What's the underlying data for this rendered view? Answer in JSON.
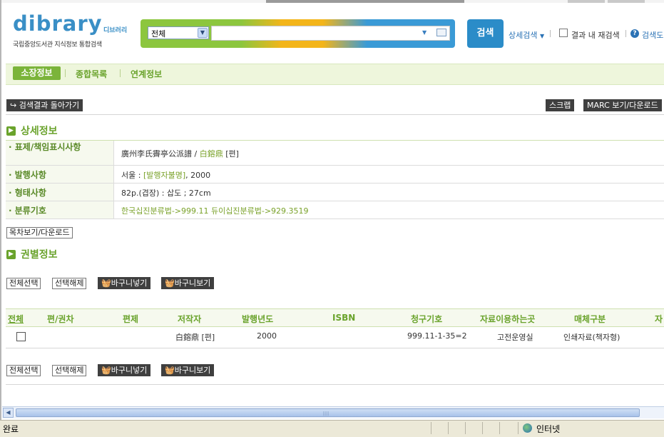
{
  "logo": {
    "wordmark": "dibrary",
    "korean": "디브러리",
    "subtitle": "국립중앙도서관 지식정보 통합검색"
  },
  "search": {
    "scope_value": "전체",
    "query": "",
    "button": "검색",
    "advanced": "상세검색",
    "within_results": "결과 내 재검색",
    "help": "검색도"
  },
  "tabs": [
    "소장정보",
    "종합목록",
    "연계정보"
  ],
  "actions": {
    "back": "검색결과 돌아가기",
    "scrap": "스크랩",
    "marc": "MARC 보기/다운로드",
    "toc": "목차보기/다운로드"
  },
  "detail": {
    "heading": "상세정보",
    "rows": [
      {
        "label": "· 표제/책임표시사항",
        "value": "廣州李氏霽亭公派譜 / ",
        "link": "白鎔鼎",
        "suffix": " [편]"
      },
      {
        "label": "· 발행사항",
        "value": "서울 : ",
        "link": "[발행자불명]",
        "suffix": ", 2000"
      },
      {
        "label": "· 형태사항",
        "value": "82p.(겹장) : 삽도 ; 27cm",
        "link": "",
        "suffix": ""
      },
      {
        "label": "· 분류기호",
        "value": "",
        "link": "한국십진분류법->999.11  듀이십진분류법->929.3519",
        "suffix": ""
      }
    ]
  },
  "volume": {
    "heading": "권별정보",
    "select_all": "전체선택",
    "deselect": "선택해제",
    "basket_add": "바구니넣기",
    "basket_view": "바구니보기",
    "columns": [
      "전체",
      "편/권차",
      "편제",
      "저작자",
      "발행년도",
      "ISBN",
      "청구기호",
      "자료이용하는곳",
      "매체구분",
      "자"
    ],
    "rows": [
      {
        "edition": "",
        "part": "",
        "author": "白鎔鼎 [편]",
        "year": "2000",
        "isbn": "",
        "call_no": "999.11-1-35=2",
        "location": "고전운영실",
        "media": "인쇄자료(책자형)"
      }
    ]
  },
  "status": {
    "text": "완료",
    "zone": "인터넷"
  },
  "colors": {
    "accent_green": "#6aa32c",
    "search_blue": "#2b8cc8",
    "link_green": "#7aa22a"
  }
}
